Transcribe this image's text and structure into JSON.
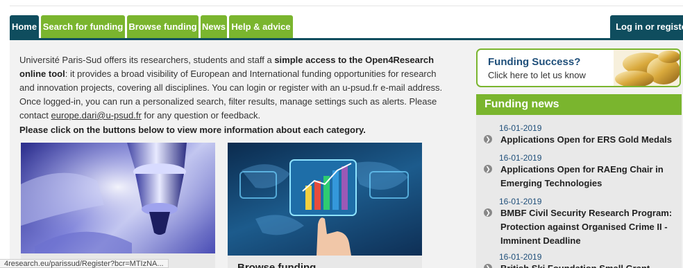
{
  "nav": {
    "home": "Home",
    "search": "Search for funding",
    "browse": "Browse funding",
    "news": "News",
    "help": "Help & advice",
    "login": "Log in or registe"
  },
  "intro": {
    "part1": "Université Paris-Sud offers its researchers, students and staff a ",
    "bold": "simple access to the Open4Research online tool",
    "part2": ": it provides a broad visibility of European and International funding opportunities for research and innovation projects, covering all disciplines. You can login or register with an u-psud.fr e-mail address. Once logged-in, you can run a personalized search, filter results, manage settings such as alerts. Please contact ",
    "email": "europe.dari@u-psud.fr",
    "part3": " for any question or feedback."
  },
  "cta": "Please click on the buttons below to view more information about each category.",
  "cards": {
    "card2_title": "Browse funding"
  },
  "status_url": "4research.eu/parissud/Register?bcr=MTIzNA...",
  "success": {
    "title": "Funding Success?",
    "subtitle": "Click here to let us know"
  },
  "news": {
    "heading": "Funding news",
    "items": [
      {
        "date": "16-01-2019",
        "title": "Applications Open for ERS Gold Medals"
      },
      {
        "date": "16-01-2019",
        "title": "Applications Open for RAEng Chair in Emerging Technologies"
      },
      {
        "date": "16-01-2019",
        "title": "BMBF Civil Security Research Program: Protection against Organised Crime II - Imminent Deadline"
      },
      {
        "date": "16-01-2019",
        "title": "British Ski Foundation Small Grant"
      }
    ]
  },
  "colors": {
    "green": "#7ab52e",
    "navy": "#0f4d5e",
    "link_blue": "#1f4f7a"
  },
  "icons": [
    "chevron-right-icon"
  ]
}
